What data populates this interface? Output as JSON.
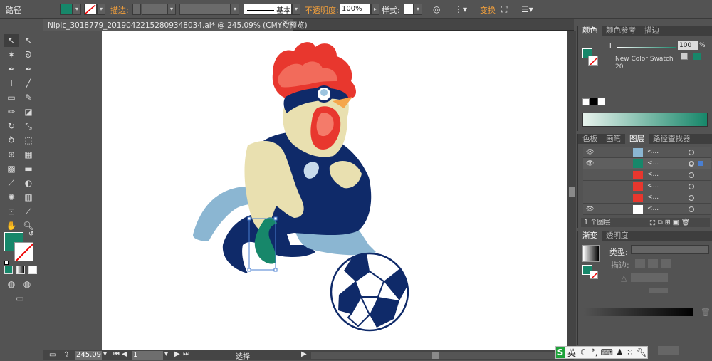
{
  "control_bar": {
    "selection_label": "路径",
    "stroke_label": "描边:",
    "stroke_style": "基本",
    "opacity_label": "不透明度:",
    "opacity_value": "100%",
    "style_label": "样式:",
    "transform_label": "变换"
  },
  "document_tab": {
    "title": "Nipic_3018779_20190422152809348034.ai* @ 245.09% (CMYK/预览)"
  },
  "color_panel": {
    "tabs": [
      "颜色",
      "颜色参考",
      "描边"
    ],
    "t_label": "T",
    "tint_value": "100",
    "swatch_name": "New Color Swatch 20",
    "fill_color": "#17876a"
  },
  "layers_panel": {
    "tabs": [
      "色板",
      "画笔",
      "图层",
      "路径查找器"
    ],
    "layer_count": "1 个图层",
    "rows": [
      {
        "name": "<..."
      },
      {
        "name": "<..."
      },
      {
        "name": "<..."
      },
      {
        "name": "<..."
      },
      {
        "name": "<..."
      },
      {
        "name": "<..."
      }
    ]
  },
  "gradient_panel": {
    "tabs": [
      "渐变",
      "透明度"
    ],
    "type_label": "类型:",
    "stroke_label": "描边:"
  },
  "status_bar": {
    "zoom": "245.09",
    "page": "1",
    "tool": "选择"
  },
  "ime": {
    "lang": "英"
  },
  "colors": {
    "accent": "#f7a23b",
    "fill_green": "#17876a",
    "navy": "#0d2a6b"
  }
}
